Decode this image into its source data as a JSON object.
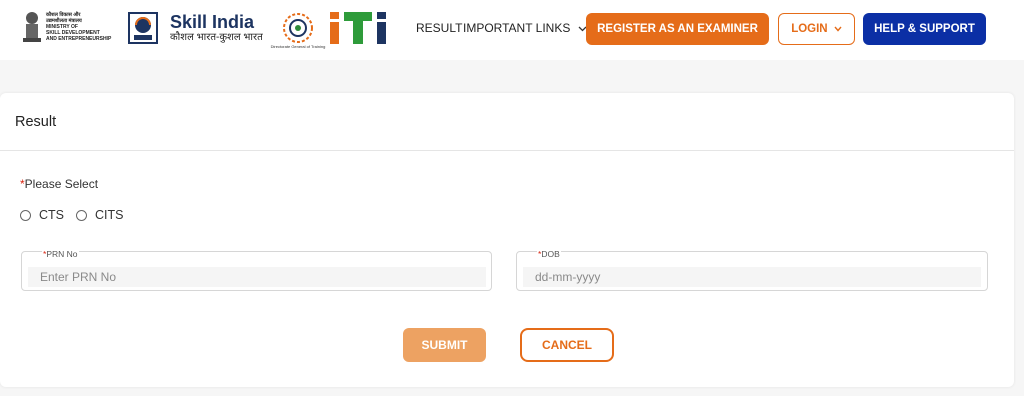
{
  "header": {
    "ministry_lines": [
      "कौशल विकास और",
      "उद्यमशीलता मंत्रालय",
      "MINISTRY OF",
      "SKILL DEVELOPMENT",
      "AND ENTREPRENEURSHIP"
    ],
    "skill_india_title": "Skill India",
    "skill_india_sub": "कौशल भारत-कुशल भारत",
    "dgt_caption": "Directorate General of Training",
    "nav": {
      "result": "RESULT",
      "important_links": "IMPORTANT LINKS"
    },
    "buttons": {
      "register": "REGISTER AS AN EXAMINER",
      "login": "LOGIN",
      "help": "HELP & SUPPORT"
    }
  },
  "card": {
    "title": "Result",
    "select_label": "Please Select",
    "required_mark": "*",
    "radio_options": [
      "CTS",
      "CITS"
    ],
    "fields": {
      "prn": {
        "label": "PRN No",
        "placeholder": "Enter PRN No",
        "value": ""
      },
      "dob": {
        "label": "DOB",
        "placeholder": "dd-mm-yyyy",
        "value": ""
      }
    },
    "submit_label": "SUBMIT",
    "cancel_label": "CANCEL"
  },
  "colors": {
    "accent_orange": "#e56c19",
    "submit_disabled": "#eda262",
    "help_blue": "#0b2fa5",
    "required_red": "#d9230f"
  }
}
